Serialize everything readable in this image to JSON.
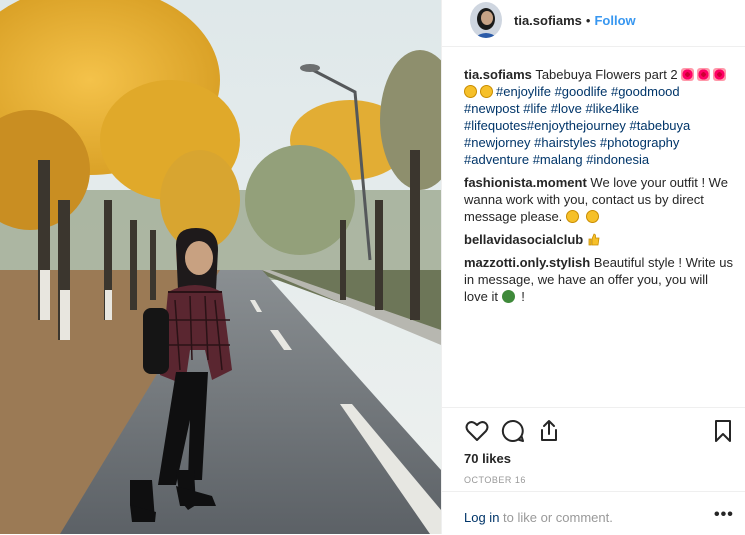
{
  "header": {
    "username": "tia.sofiams",
    "separator": "•",
    "follow_label": "Follow",
    "avatar_icon": "profile-photo-avatar"
  },
  "caption": {
    "user": "tia.sofiams",
    "text": "Tabebuya Flowers part 2",
    "hashtags": [
      "#enjoylife",
      "#goodlife",
      "#goodmood",
      "#newpost",
      "#life",
      "#love",
      "#like4like",
      "#lifequotes",
      "#enjoythejourney",
      "#tabebuya",
      "#newjorney",
      "#hairstyles",
      "#photography",
      "#adventure",
      "#malang",
      "#indonesia"
    ]
  },
  "comments": [
    {
      "user": "fashionista.moment",
      "text": "We love your outfit ! We wanna work with you, contact us by direct message please."
    },
    {
      "user": "bellavidasocialclub",
      "text": ""
    },
    {
      "user": "mazzotti.only.stylish",
      "text": "Beautiful style ! Write us in message, we have an offer you, you will love it",
      "tail": "!"
    }
  ],
  "actions": {
    "like_icon": "heart-icon",
    "comment_icon": "comment-icon",
    "share_icon": "share-icon",
    "save_icon": "bookmark-icon"
  },
  "likes": "70 likes",
  "date": "OCTOBER 16",
  "footer": {
    "login_link": "Log in",
    "login_text": "to like or comment.",
    "more_label": "•••"
  },
  "colors": {
    "accent": "#3897f0",
    "hashtag": "#003569",
    "muted": "#999999",
    "border": "#efefef"
  }
}
